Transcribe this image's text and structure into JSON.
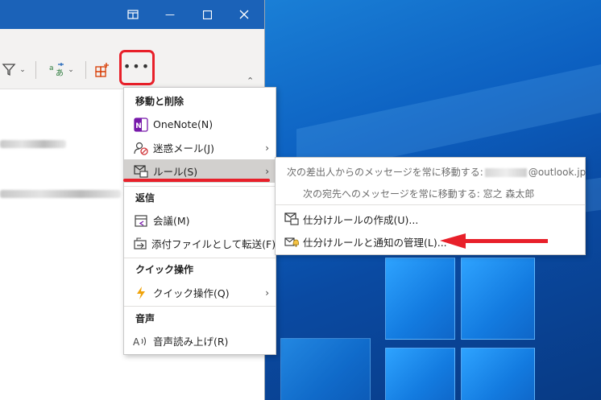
{
  "titlebar": {
    "restore_glyph": "⊡",
    "minimize_glyph": "—",
    "maximize_glyph": "☐",
    "close_glyph": "✕"
  },
  "ribbon": {
    "more_glyph": "•••",
    "collapse_glyph": "⌃"
  },
  "menu": {
    "section_move_delete": "移動と削除",
    "onenote": "OneNote(N)",
    "junk": "迷惑メール(J)",
    "rules": "ルール(S)",
    "section_respond": "返信",
    "meeting": "会議(M)",
    "forward_attachment": "添付ファイルとして転送(F)",
    "section_quick_steps": "クイック操作",
    "quick_steps": "クイック操作(Q)",
    "section_speech": "音声",
    "read_aloud": "音声読み上げ(R)"
  },
  "submenu": {
    "always_move_from_prefix": "次の差出人からのメッセージを常に移動する:",
    "always_move_from_suffix": "@outlook.jp",
    "always_move_to": "次の宛先へのメッセージを常に移動する: 窓之 森太郎",
    "create_rule": "仕分けルールの作成(U)...",
    "manage_rules": "仕分けルールと通知の管理(L)..."
  },
  "colors": {
    "titlebar": "#1b62b8",
    "highlight_red": "#e8202a",
    "onenote_purple": "#7719aa",
    "quick_step_orange": "#f0a30a"
  }
}
